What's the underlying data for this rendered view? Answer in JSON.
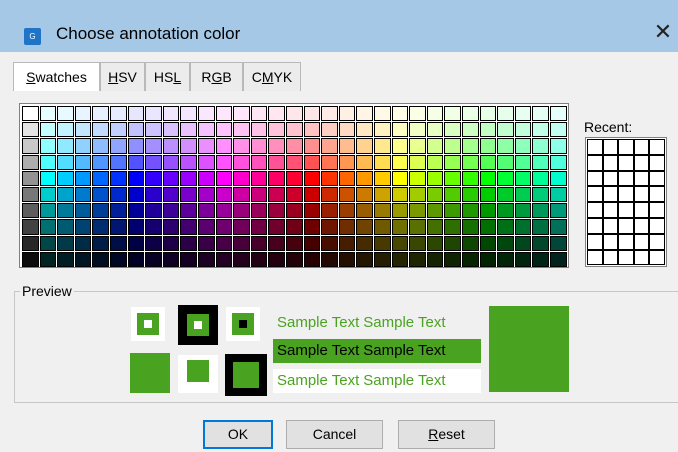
{
  "window": {
    "title": "Choose annotation color",
    "close_glyph": "✕",
    "app_icon_text": "G"
  },
  "tabs": [
    {
      "pre": "",
      "u": "S",
      "post": "watches",
      "active": true
    },
    {
      "pre": "",
      "u": "H",
      "post": "SV",
      "active": false
    },
    {
      "pre": "HS",
      "u": "L",
      "post": "",
      "active": false
    },
    {
      "pre": "R",
      "u": "G",
      "post": "B",
      "active": false
    },
    {
      "pre": "C",
      "u": "M",
      "post": "YK",
      "active": false
    }
  ],
  "recent_label": "Recent:",
  "preview": {
    "label": "Preview",
    "color": "#4aa320",
    "sample_text": "Sample Text"
  },
  "buttons": {
    "ok": "OK",
    "cancel": "Cancel",
    "reset_u": "R",
    "reset_rest": "eset"
  }
}
